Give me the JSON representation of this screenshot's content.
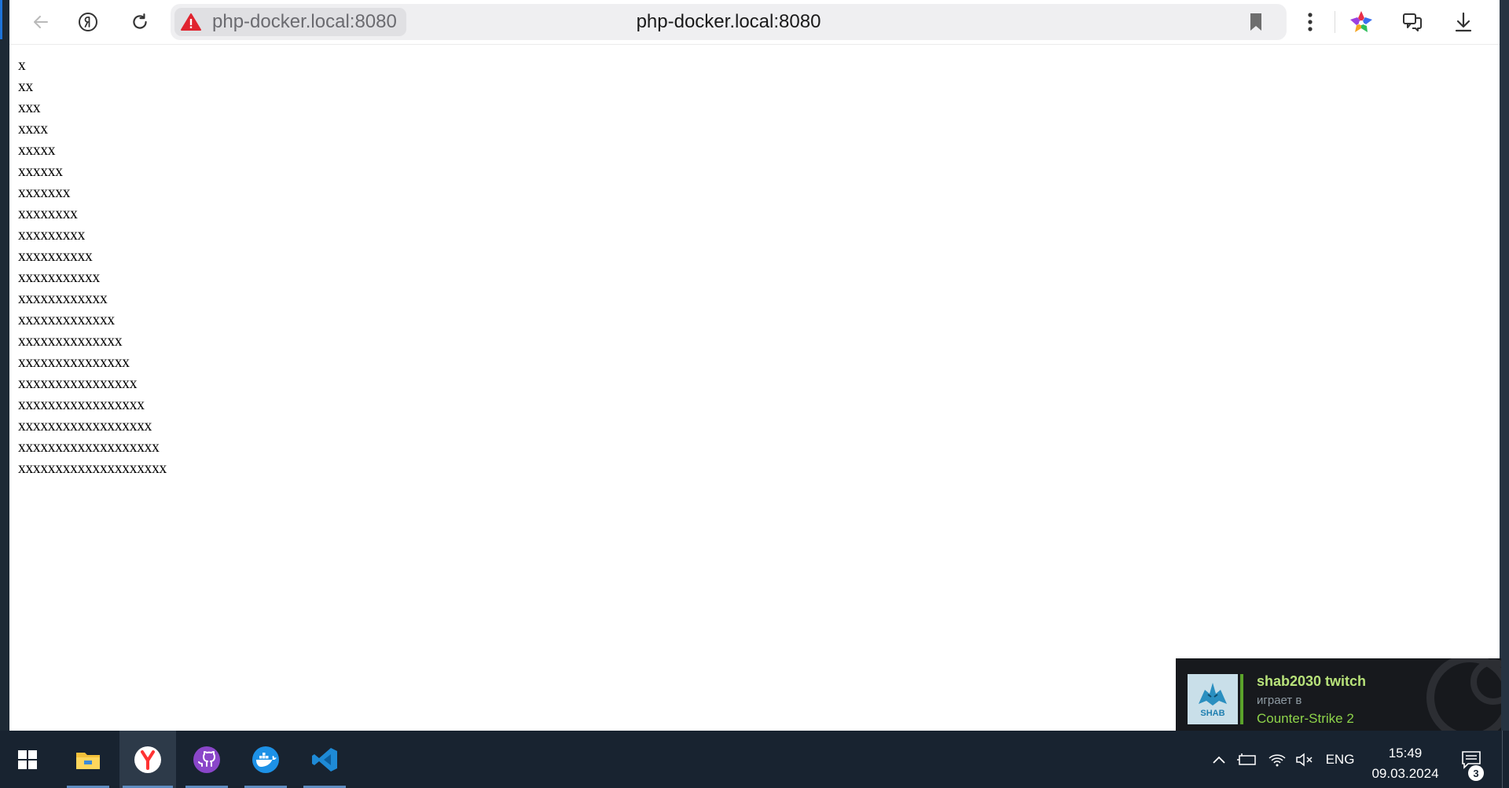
{
  "browser": {
    "address_chip_text": "php-docker.local:8080",
    "address_center_text": "php-docker.local:8080",
    "security_status": "warning"
  },
  "page": {
    "lines": [
      "x",
      "xx",
      "xxx",
      "xxxx",
      "xxxxx",
      "xxxxxx",
      "xxxxxxx",
      "xxxxxxxx",
      "xxxxxxxxx",
      "xxxxxxxxxx",
      "xxxxxxxxxxx",
      "xxxxxxxxxxxx",
      "xxxxxxxxxxxxx",
      "xxxxxxxxxxxxxx",
      "xxxxxxxxxxxxxxx",
      "xxxxxxxxxxxxxxxx",
      "xxxxxxxxxxxxxxxxx",
      "xxxxxxxxxxxxxxxxxx",
      "xxxxxxxxxxxxxxxxxxx",
      "xxxxxxxxxxxxxxxxxxxx"
    ]
  },
  "notification": {
    "name": "shab2030 twitch",
    "status": "играет в",
    "game": "Counter-Strike 2",
    "avatar_text": "SHAB",
    "accent_color": "#8ed34a"
  },
  "taskbar": {
    "apps": [
      "start-icon",
      "file-explorer-icon",
      "yandex-browser-icon",
      "github-desktop-icon",
      "docker-icon",
      "vscode-icon"
    ],
    "language": "ENG",
    "time": "15:49",
    "date": "09.03.2024",
    "notification_count": "3"
  }
}
